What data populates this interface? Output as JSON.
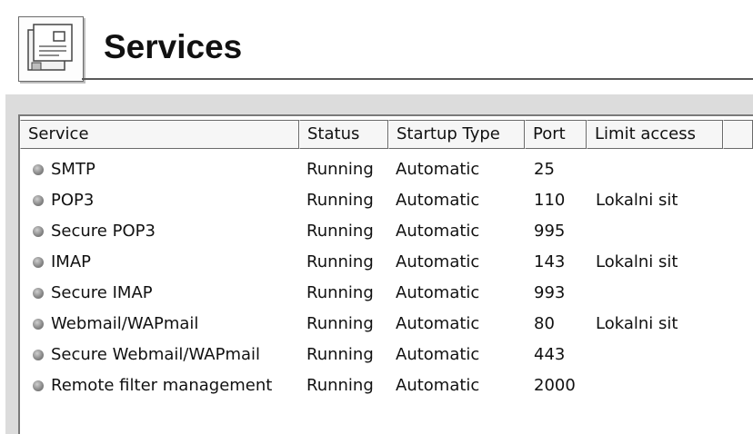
{
  "header": {
    "title": "Services",
    "icon": "services-document-icon"
  },
  "columns": [
    "Service",
    "Status",
    "Startup Type",
    "Port",
    "Limit access",
    ""
  ],
  "rows": [
    {
      "service": "SMTP",
      "status": "Running",
      "startup": "Automatic",
      "port": "25",
      "limit": ""
    },
    {
      "service": "POP3",
      "status": "Running",
      "startup": "Automatic",
      "port": "110",
      "limit": "Lokalni sit"
    },
    {
      "service": "Secure POP3",
      "status": "Running",
      "startup": "Automatic",
      "port": "995",
      "limit": ""
    },
    {
      "service": "IMAP",
      "status": "Running",
      "startup": "Automatic",
      "port": "143",
      "limit": "Lokalni sit"
    },
    {
      "service": "Secure IMAP",
      "status": "Running",
      "startup": "Automatic",
      "port": "993",
      "limit": ""
    },
    {
      "service": "Webmail/WAPmail",
      "status": "Running",
      "startup": "Automatic",
      "port": "80",
      "limit": "Lokalni sit"
    },
    {
      "service": "Secure Webmail/WAPmail",
      "status": "Running",
      "startup": "Automatic",
      "port": "443",
      "limit": ""
    },
    {
      "service": "Remote filter management",
      "status": "Running",
      "startup": "Automatic",
      "port": "2000",
      "limit": ""
    }
  ],
  "colors": {
    "panel_bg": "#dcdcdc",
    "status_dot": "#8a8a8a"
  }
}
